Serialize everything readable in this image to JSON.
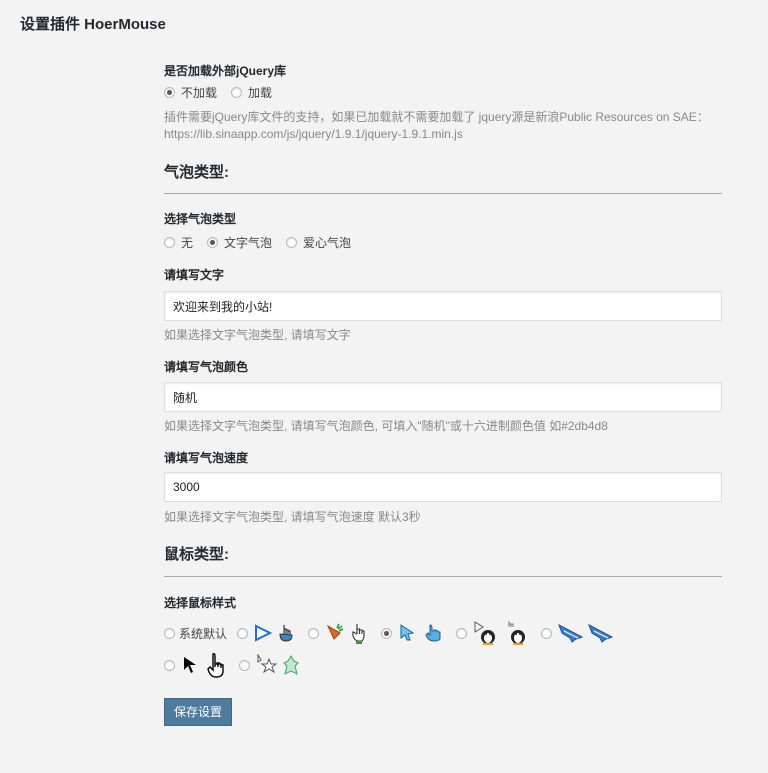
{
  "page": {
    "title": "设置插件 HoerMouse"
  },
  "jquery": {
    "label": "是否加载外部jQuery库",
    "options": [
      "不加载",
      "加载"
    ],
    "selected": "不加载",
    "desc_line1": "插件需要jQuery库文件的支持，如果已加载就不需要加载了 jquery源是新浪Public Resources on SAE：",
    "desc_line2": "https://lib.sinaapp.com/js/jquery/1.9.1/jquery-1.9.1.min.js"
  },
  "bubble_section": {
    "heading": "气泡类型:"
  },
  "bubble_type": {
    "label": "选择气泡类型",
    "options": [
      "无",
      "文字气泡",
      "爱心气泡"
    ],
    "selected": "文字气泡"
  },
  "bubble_text": {
    "label": "请填写文字",
    "value": "欢迎来到我的小站!",
    "desc": "如果选择文字气泡类型, 请填写文字"
  },
  "bubble_color": {
    "label": "请填写气泡颜色",
    "value": "随机",
    "desc": "如果选择文字气泡类型, 请填写气泡颜色, 可填入\"随机\"或十六进制颜色值 如#2db4d8"
  },
  "bubble_speed": {
    "label": "请填写气泡速度",
    "value": "3000",
    "desc": "如果选择文字气泡类型, 请填写气泡速度 默认3秒"
  },
  "mouse_section": {
    "heading": "鼠标类型:"
  },
  "cursor_style": {
    "label": "选择鼠标样式",
    "default_option": "系统默认",
    "selected_index": 3,
    "options": [
      {
        "icons": []
      },
      {
        "icons": [
          "blue-triangle-arrow-icon",
          "hand-pointer-icon"
        ]
      },
      {
        "icons": [
          "carrot-icon",
          "green-hand-icon"
        ]
      },
      {
        "icons": [
          "blue-gem-arrow-icon",
          "blue-hand-icon"
        ]
      },
      {
        "icons": [
          "penguin-arrow-icon",
          "penguin-hand-icon"
        ]
      },
      {
        "icons": [
          "shark-icon",
          "shark-icon-2"
        ]
      },
      {
        "icons": [
          "black-arrow-icon",
          "black-hand-icon"
        ]
      },
      {
        "icons": [
          "star-arrow-icon",
          "green-ghost-icon"
        ]
      }
    ]
  },
  "actions": {
    "save_label": "保存设置"
  },
  "colors": {
    "save_button": "#4e7c9c",
    "background": "#f3f3f3"
  }
}
